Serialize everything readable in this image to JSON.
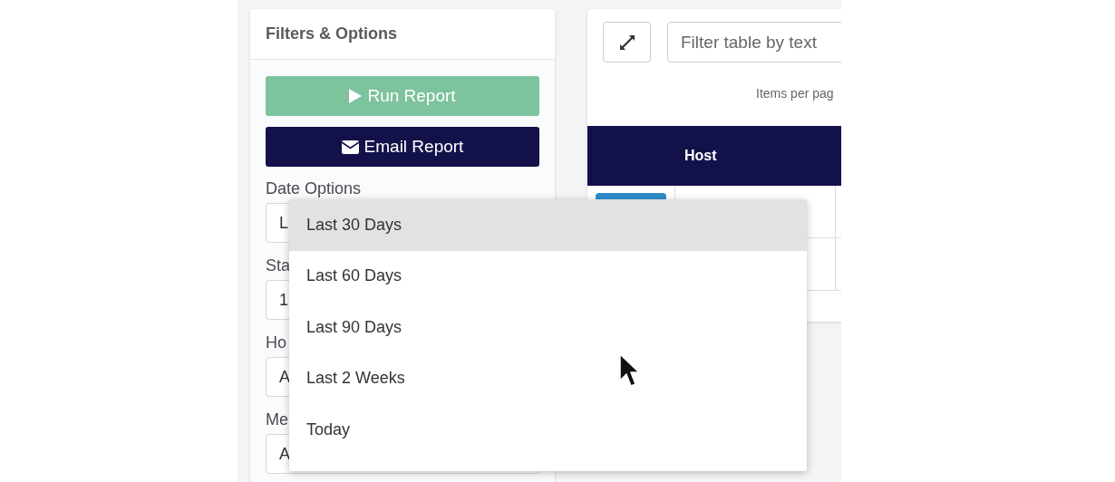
{
  "filters_panel": {
    "title": "Filters & Options",
    "buttons": [
      {
        "kind": "run",
        "label": "Run Report"
      },
      {
        "kind": "email",
        "label": "Email Report"
      }
    ],
    "fields": [
      {
        "label": "Date Options",
        "value": "L"
      },
      {
        "label": "Sta",
        "value": "1"
      },
      {
        "label": "Ho",
        "value": "A"
      },
      {
        "label": "Me",
        "value": "A"
      }
    ]
  },
  "table_panel": {
    "filter": {
      "placeholder": "Filter table by text"
    },
    "items_per_page": "Items per pag",
    "columns": [
      "Host"
    ]
  },
  "dropdown": {
    "options": [
      {
        "label": "Last 30 Days",
        "selected": true
      },
      {
        "label": "Last 60 Days",
        "selected": false
      },
      {
        "label": "Last 90 Days",
        "selected": false
      },
      {
        "label": "Last 2 Weeks",
        "selected": false
      },
      {
        "label": "Today",
        "selected": false
      }
    ]
  }
}
